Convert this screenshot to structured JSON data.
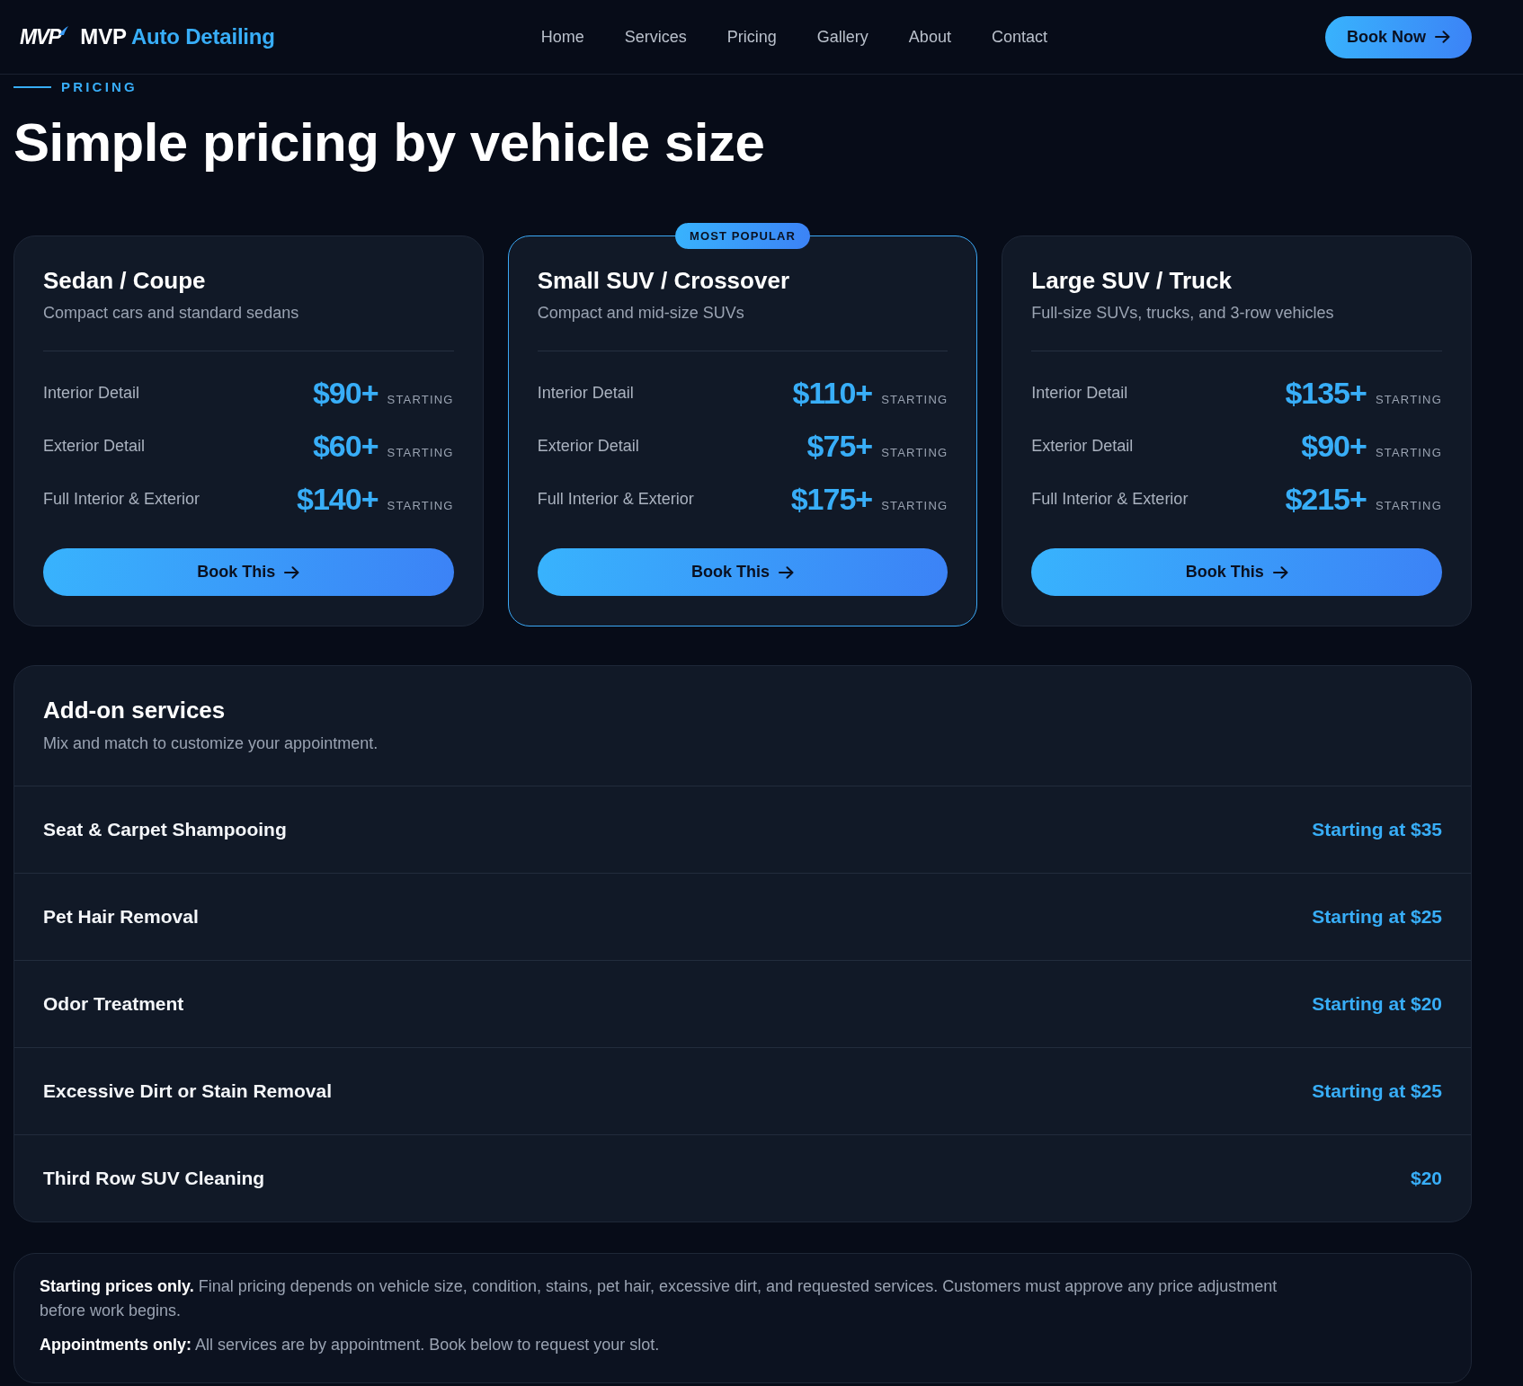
{
  "header": {
    "logo": "MVP",
    "brand": {
      "name": "MVP",
      "accent": "Auto Detailing"
    },
    "nav": [
      "Home",
      "Services",
      "Pricing",
      "Gallery",
      "About",
      "Contact"
    ],
    "cta": "Book Now"
  },
  "section": {
    "eyebrow": "PRICING",
    "title": "Simple pricing by vehicle size"
  },
  "plans": [
    {
      "title": "Sedan / Coupe",
      "subtitle": "Compact cars and standard sedans",
      "featured": false,
      "rows": [
        {
          "service": "Interior Detail",
          "price": "$90+",
          "note": "STARTING"
        },
        {
          "service": "Exterior Detail",
          "price": "$60+",
          "note": "STARTING"
        },
        {
          "service": "Full Interior & Exterior",
          "price": "$140+",
          "note": "STARTING"
        }
      ],
      "button": "Book This"
    },
    {
      "title": "Small SUV / Crossover",
      "subtitle": "Compact and mid-size SUVs",
      "featured": true,
      "badge": "MOST POPULAR",
      "rows": [
        {
          "service": "Interior Detail",
          "price": "$110+",
          "note": "STARTING"
        },
        {
          "service": "Exterior Detail",
          "price": "$75+",
          "note": "STARTING"
        },
        {
          "service": "Full Interior & Exterior",
          "price": "$175+",
          "note": "STARTING"
        }
      ],
      "button": "Book This"
    },
    {
      "title": "Large SUV / Truck",
      "subtitle": "Full-size SUVs, trucks, and 3-row vehicles",
      "featured": false,
      "rows": [
        {
          "service": "Interior Detail",
          "price": "$135+",
          "note": "STARTING"
        },
        {
          "service": "Exterior Detail",
          "price": "$90+",
          "note": "STARTING"
        },
        {
          "service": "Full Interior & Exterior",
          "price": "$215+",
          "note": "STARTING"
        }
      ],
      "button": "Book This"
    }
  ],
  "addons": {
    "title": "Add-on services",
    "subtitle": "Mix and match to customize your appointment.",
    "items": [
      {
        "name": "Seat & Carpet Shampooing",
        "price": "Starting at $35"
      },
      {
        "name": "Pet Hair Removal",
        "price": "Starting at $25"
      },
      {
        "name": "Odor Treatment",
        "price": "Starting at $20"
      },
      {
        "name": "Excessive Dirt or Stain Removal",
        "price": "Starting at $25"
      },
      {
        "name": "Third Row SUV Cleaning",
        "price": "$20"
      }
    ]
  },
  "notes": [
    "**Starting prices only.** Final pricing depends on vehicle size, condition, stains, pet hair, excessive dirt, and requested services. Customers must approve any price adjustment before work begins.",
    "**Appointments only:** All services are by appointment. Book below to request your slot."
  ]
}
